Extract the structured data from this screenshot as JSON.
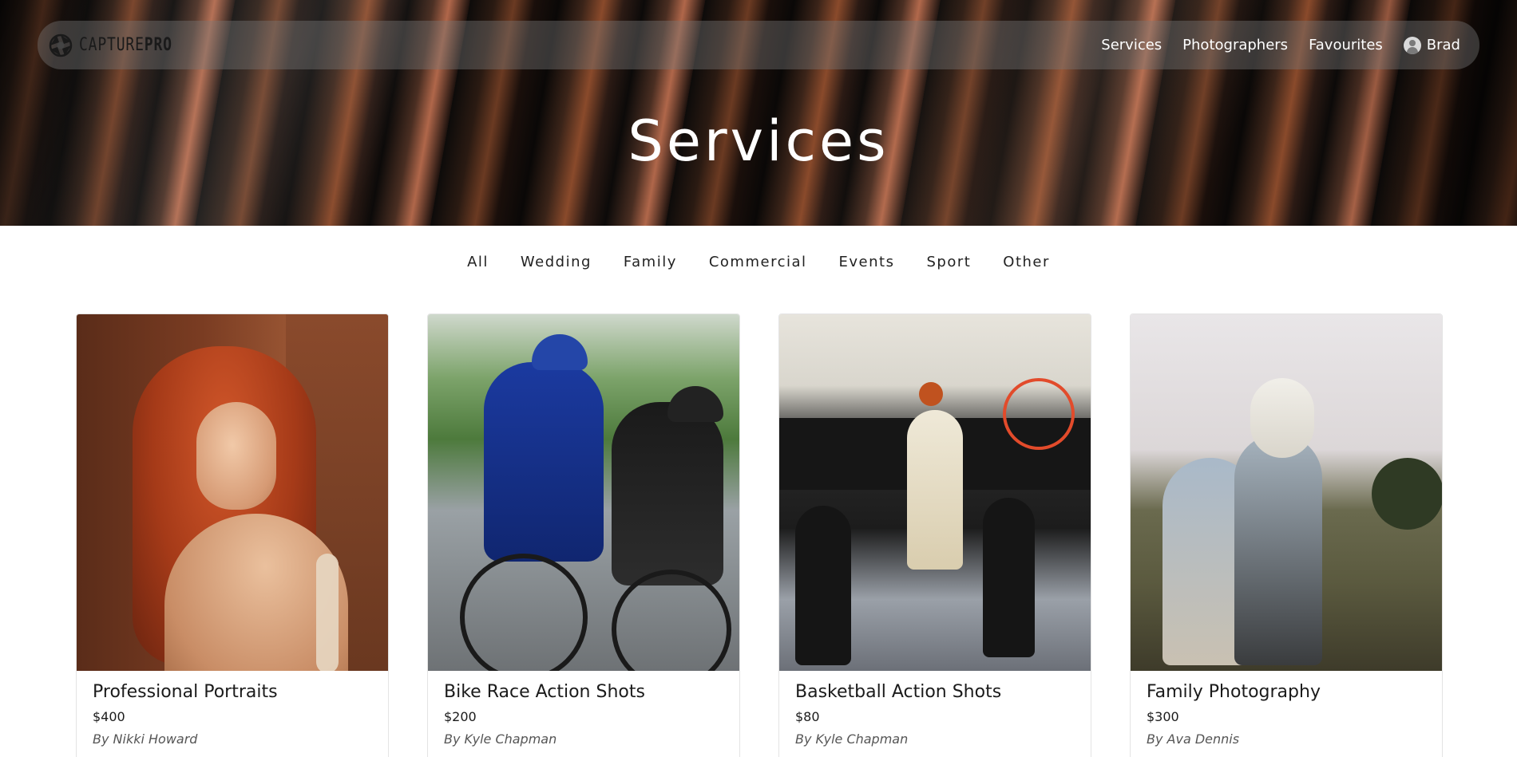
{
  "brand": {
    "name_light": "CAPTURE",
    "name_bold": "PRO"
  },
  "nav": {
    "links": [
      "Services",
      "Photographers",
      "Favourites"
    ],
    "user": "Brad"
  },
  "hero": {
    "title": "Services"
  },
  "filters": [
    "All",
    "Wedding",
    "Family",
    "Commercial",
    "Events",
    "Sport",
    "Other"
  ],
  "cards": [
    {
      "title": "Professional Portraits",
      "price": "$400",
      "author": "By Nikki Howard"
    },
    {
      "title": "Bike Race Action Shots",
      "price": "$200",
      "author": "By Kyle Chapman"
    },
    {
      "title": "Basketball Action Shots",
      "price": "$80",
      "author": "By Kyle Chapman"
    },
    {
      "title": "Family Photography",
      "price": "$300",
      "author": "By Ava Dennis"
    }
  ]
}
